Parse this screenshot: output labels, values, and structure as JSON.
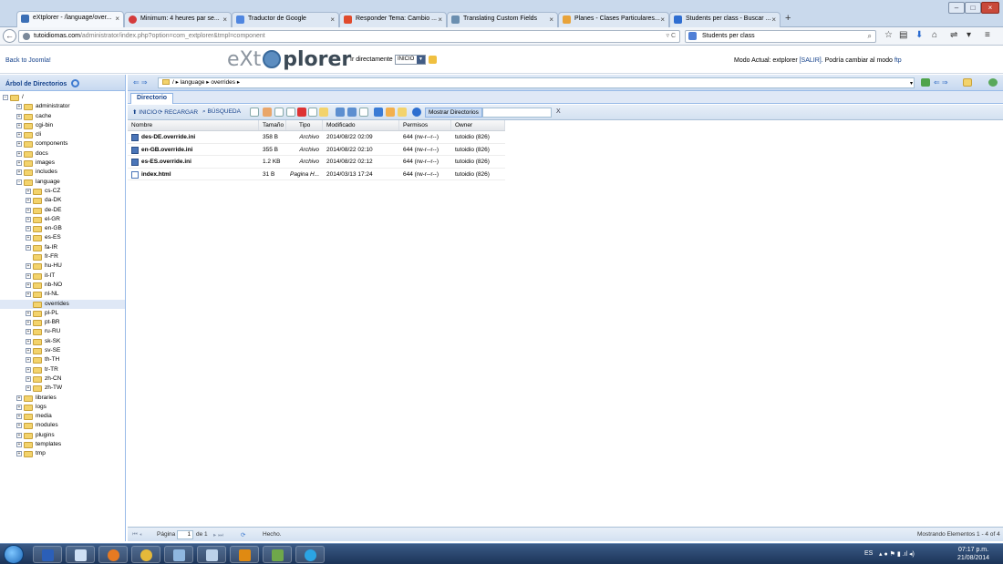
{
  "browser": {
    "tabs": [
      {
        "label": "eXtplorer - /language/over...",
        "active": true
      },
      {
        "label": "Minimum: 4 heures par se..."
      },
      {
        "label": "Traductor de Google"
      },
      {
        "label": "Responder Tema: Cambio ..."
      },
      {
        "label": "Translating Custom Fields"
      },
      {
        "label": "Planes - Clases Particulares..."
      },
      {
        "label": "Students per class - Buscar ..."
      }
    ],
    "new_tab": "+",
    "url_host": "tutoidiomas.com",
    "url_path": "/administrator/index.php?option=com_extplorer&tmpl=component",
    "search_value": "Students per class"
  },
  "app": {
    "back_link": "Back to Joomla!",
    "logo_left": "eXt",
    "logo_right": "plorer",
    "goto_label": "Ir directamente a:",
    "goto_value": "INICIO",
    "mode_prefix": "Modo Actual: extplorer",
    "mode_logout": "[SALIR].",
    "mode_suffix": "Podría cambiar al modo",
    "mode_ftp": "ftp"
  },
  "tree": {
    "title": "Árbol de Directorios",
    "root": "/",
    "items": [
      {
        "label": "administrator",
        "level": 1
      },
      {
        "label": "cache",
        "level": 1
      },
      {
        "label": "cgi-bin",
        "level": 1
      },
      {
        "label": "cli",
        "level": 1
      },
      {
        "label": "components",
        "level": 1
      },
      {
        "label": "docs",
        "level": 1
      },
      {
        "label": "images",
        "level": 1
      },
      {
        "label": "includes",
        "level": 1
      },
      {
        "label": "language",
        "level": 1,
        "expanded": true
      },
      {
        "label": "cs-CZ",
        "level": 2
      },
      {
        "label": "da-DK",
        "level": 2
      },
      {
        "label": "de-DE",
        "level": 2
      },
      {
        "label": "el-GR",
        "level": 2
      },
      {
        "label": "en-GB",
        "level": 2
      },
      {
        "label": "es-ES",
        "level": 2
      },
      {
        "label": "fa-IR",
        "level": 2
      },
      {
        "label": "fr-FR",
        "level": 2,
        "leaf": true
      },
      {
        "label": "hu-HU",
        "level": 2
      },
      {
        "label": "it-IT",
        "level": 2
      },
      {
        "label": "nb-NO",
        "level": 2
      },
      {
        "label": "nl-NL",
        "level": 2
      },
      {
        "label": "overrides",
        "level": 2,
        "leaf": true,
        "selected": true
      },
      {
        "label": "pl-PL",
        "level": 2
      },
      {
        "label": "pt-BR",
        "level": 2
      },
      {
        "label": "ru-RU",
        "level": 2
      },
      {
        "label": "sk-SK",
        "level": 2
      },
      {
        "label": "sv-SE",
        "level": 2
      },
      {
        "label": "th-TH",
        "level": 2
      },
      {
        "label": "tr-TR",
        "level": 2
      },
      {
        "label": "zh-CN",
        "level": 2
      },
      {
        "label": "zh-TW",
        "level": 2
      },
      {
        "label": "libraries",
        "level": 1
      },
      {
        "label": "logs",
        "level": 1
      },
      {
        "label": "media",
        "level": 1
      },
      {
        "label": "modules",
        "level": 1
      },
      {
        "label": "plugins",
        "level": 1
      },
      {
        "label": "templates",
        "level": 1
      },
      {
        "label": "tmp",
        "level": 1
      }
    ]
  },
  "main": {
    "path_root": "/",
    "path_parts": [
      "language",
      "overrides"
    ],
    "tab_label": "Directorio",
    "toolbar": {
      "home": "INICIO",
      "reload": "RECARGAR",
      "search": "BÚSQUEDA",
      "show_dirs": "Mostrar Directorios",
      "filter_clear": "X"
    },
    "columns": [
      "Nombre",
      "Tamaño",
      "Tipo",
      "Modificado",
      "Permisos",
      "Owner"
    ],
    "rows": [
      {
        "name": "des-DE.override.ini",
        "size": "358 B",
        "type": "Archivo",
        "modified": "2014/08/22 02:09",
        "perms": "644 (rw-r--r--)",
        "owner": "tutoidio (826)",
        "icon": "ini-file-icon"
      },
      {
        "name": "en-GB.override.ini",
        "size": "355 B",
        "type": "Archivo",
        "modified": "2014/08/22 02:10",
        "perms": "644 (rw-r--r--)",
        "owner": "tutoidio (826)",
        "icon": "ini-file-icon"
      },
      {
        "name": "es-ES.override.ini",
        "size": "1.2 KB",
        "type": "Archivo",
        "modified": "2014/08/22 02:12",
        "perms": "644 (rw-r--r--)",
        "owner": "tutoidio (826)",
        "icon": "ini-file-icon"
      },
      {
        "name": "index.html",
        "size": "31 B",
        "type": "Pagina H...",
        "modified": "2014/03/13 17:24",
        "perms": "644 (rw-r--r--)",
        "owner": "tutoidio (826)",
        "icon": "html-file-icon"
      }
    ],
    "footer": {
      "page_label": "Página",
      "page_value": "1",
      "page_of": "de 1",
      "status": "Hecho.",
      "showing": "Mostrando Elementos 1 - 4 of 4"
    }
  },
  "taskbar": {
    "lang": "ES",
    "time": "07:17 p.m.",
    "date": "21/08/2014"
  },
  "colors": {
    "accent": "#15428b",
    "panel_border": "#99bbe8",
    "taskbar": "#1c3458"
  }
}
